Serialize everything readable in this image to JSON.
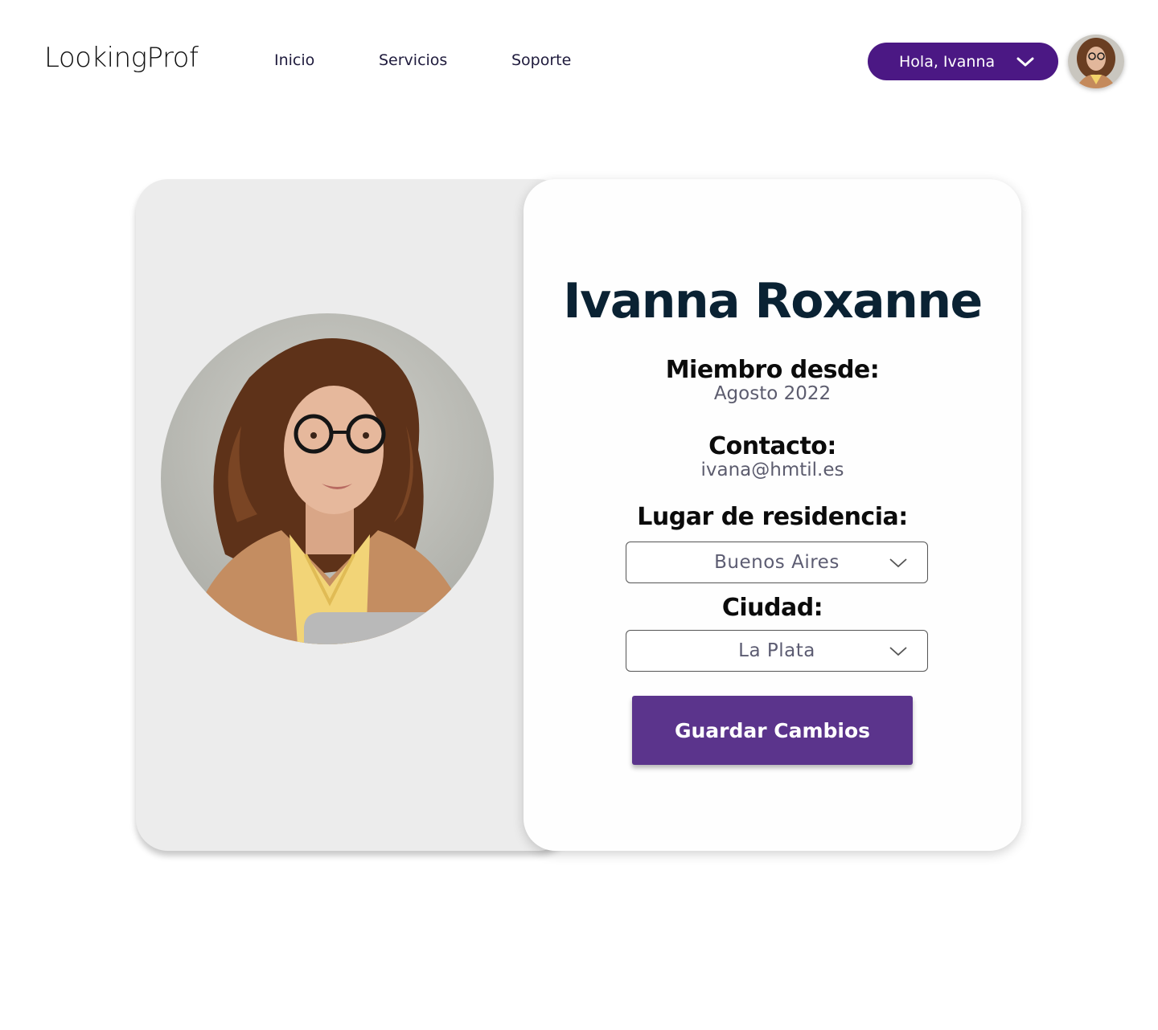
{
  "header": {
    "logo": "LookingProf",
    "nav": [
      {
        "label": "Inicio"
      },
      {
        "label": "Servicios"
      },
      {
        "label": "Soporte"
      }
    ],
    "user_menu": {
      "greeting": "Hola, Ivanna",
      "icon": "chevron-down-icon"
    },
    "avatar": "user-avatar"
  },
  "profile": {
    "photo": "profile-photo",
    "name": "Ivanna Roxanne",
    "member_since_label": "Miembro desde:",
    "member_since_value": "Agosto 2022",
    "contact_label": "Contacto:",
    "contact_value": "ivana@hmtil.es",
    "residence_label": "Lugar de residencia:",
    "residence_value": "Buenos Aires",
    "city_label": "Ciudad:",
    "city_value": "La Plata",
    "save_label": "Guardar Cambios"
  },
  "colors": {
    "accent": "#4b1884",
    "button": "#5b348c",
    "title": "#0a2233",
    "card_left_bg": "#ececec"
  }
}
